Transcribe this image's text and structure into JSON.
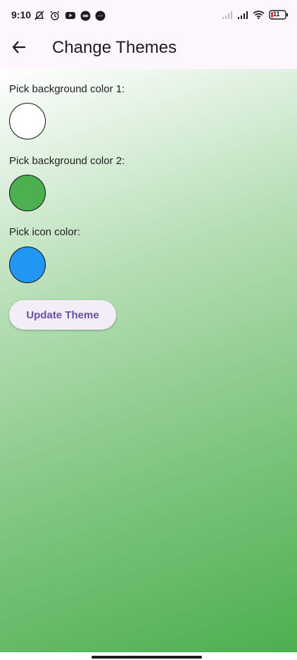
{
  "status_bar": {
    "time": "9:10",
    "battery": "11",
    "left_icons": [
      "notifications-off-icon",
      "alarm-icon",
      "youtube-icon",
      "infinity-icon",
      "messenger-icon"
    ],
    "right_icons": [
      "signal-icon",
      "signal-icon",
      "wifi-icon",
      "battery-icon"
    ]
  },
  "app_bar": {
    "title": "Change Themes",
    "back_icon": "arrow-back-icon"
  },
  "main": {
    "pickers": [
      {
        "label": "Pick background color 1:",
        "color": "#ffffff"
      },
      {
        "label": "Pick background color 2:",
        "color": "#4caf50"
      },
      {
        "label": "Pick icon color:",
        "color": "#2196f3"
      }
    ],
    "update_button_label": "Update Theme"
  },
  "colors": {
    "gradient_start": "#ffffff",
    "gradient_end": "#4caf50",
    "button_text": "#6750a4"
  }
}
